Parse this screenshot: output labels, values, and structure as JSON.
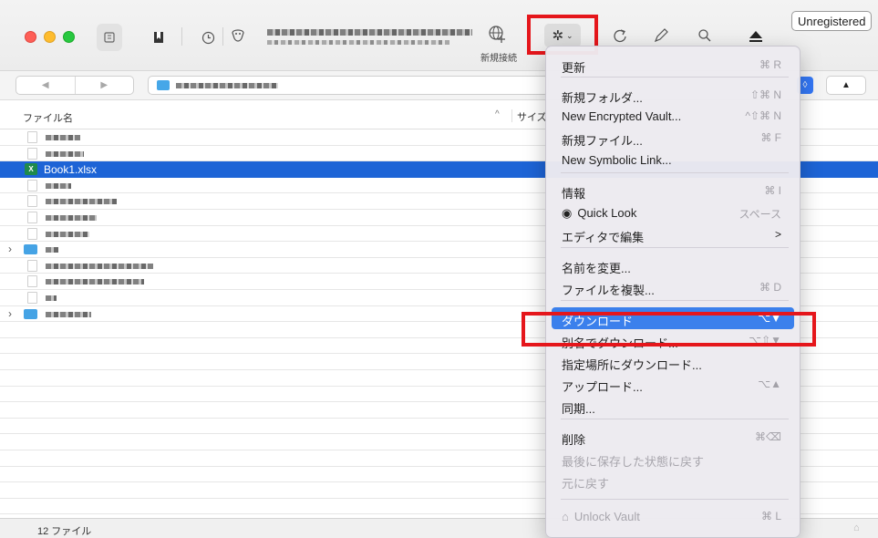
{
  "toolbar": {
    "new_connection_label": "新規接続",
    "unregistered_label": "Unregistered",
    "gear_symbol": "✲",
    "icons": [
      "sidebar-icon",
      "bookmarks-icon",
      "history-icon",
      "bonjour-icon",
      "globe-plus-icon",
      "gear-icon",
      "refresh-icon",
      "edit-icon",
      "search-icon",
      "eject-icon"
    ]
  },
  "pathbar": {
    "back_symbol": "◀",
    "forward_symbol": "▶",
    "blue_symbol": "◊",
    "eject_symbol": "▲"
  },
  "list": {
    "column_name": "ファイル名",
    "column_size": "サイズ",
    "sort_indicator": "^",
    "selected_file": "Book1.xlsx",
    "row_count": 12
  },
  "status": {
    "file_count": "12 ファイル",
    "lock": "🔒"
  },
  "menu": {
    "items": [
      {
        "label": "更新",
        "shortcut": "⌘ R"
      },
      {
        "label": "新規フォルダ...",
        "shortcut": "⇧⌘ N"
      },
      {
        "label": "New Encrypted Vault...",
        "shortcut": "^⇧⌘ N"
      },
      {
        "label": "新規ファイル...",
        "shortcut": "⌘ F"
      },
      {
        "label": "New Symbolic Link...",
        "shortcut": ""
      },
      {
        "label": "情報",
        "shortcut": "⌘ I"
      },
      {
        "label": "Quick Look",
        "shortcut": "スペース"
      },
      {
        "label": "エディタで編集",
        "shortcut": ">"
      },
      {
        "label": "名前を変更...",
        "shortcut": ""
      },
      {
        "label": "ファイルを複製...",
        "shortcut": "⌘ D"
      },
      {
        "label": "ダウンロード",
        "shortcut": "⌥▼"
      },
      {
        "label": "別名でダウンロード...",
        "shortcut": "⌥⇧▼"
      },
      {
        "label": "指定場所にダウンロード...",
        "shortcut": ""
      },
      {
        "label": "アップロード...",
        "shortcut": "⌥▲"
      },
      {
        "label": "同期...",
        "shortcut": ""
      },
      {
        "label": "削除",
        "shortcut": "⌘⌫"
      },
      {
        "label": "最後に保存した状態に戻す",
        "shortcut": ""
      },
      {
        "label": "元に戻す",
        "shortcut": ""
      },
      {
        "label": "Unlock Vault",
        "shortcut": "⌘ L"
      }
    ]
  }
}
